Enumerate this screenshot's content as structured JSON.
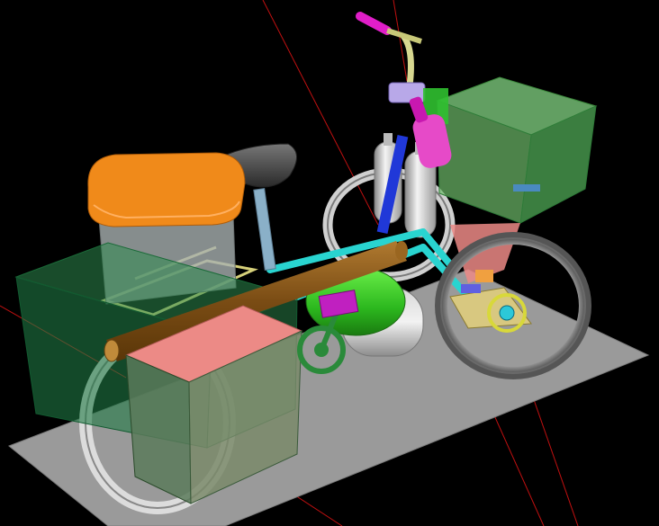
{
  "scene": {
    "background": "#000000",
    "model": "cargo-tricycle-cad-assembly",
    "parts": [
      "ground-plate",
      "rear-wheel",
      "front-left-wheel",
      "front-right-wheel",
      "frame",
      "handlebar",
      "seat",
      "orange-lid-storage-box",
      "green-rear-crate",
      "rear-pannier-box",
      "front-green-crate",
      "gas-cylinders",
      "blue-post",
      "magenta-bottle",
      "brown-tube",
      "green-tank",
      "grey-tank",
      "chainring",
      "pedal",
      "front-hub-assembly"
    ],
    "colors": {
      "ground": "#9a9a9a",
      "frame": "#29d4d0",
      "tube": "#8a5a1c",
      "lid": "#f08a1a",
      "crate_green": "#3fa060",
      "pannier": "#3e8a58",
      "lid_pink": "#ec8a86",
      "handle": "#e01ec8",
      "axis_line": "#c01010"
    }
  }
}
